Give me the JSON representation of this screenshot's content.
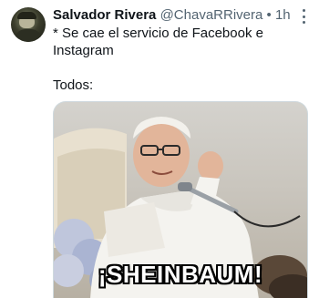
{
  "tweet": {
    "author_name": "Salvador Rivera",
    "handle": "@ChavaRRivera",
    "separator": "•",
    "time": "1h",
    "text_line1": "* Se cae el servicio de Facebook e Instagram",
    "text_line2": "Todos:"
  },
  "media": {
    "caption": "¡SHEINBAUM!"
  },
  "icons": {
    "more": "more-dots-icon"
  }
}
